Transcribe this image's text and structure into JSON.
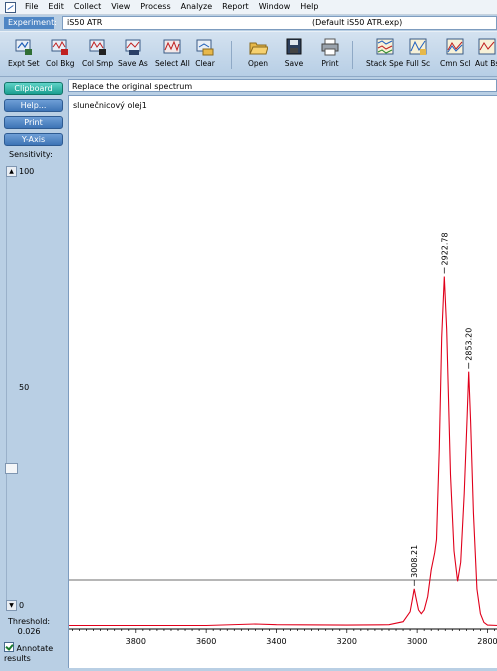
{
  "menu": {
    "items": [
      "File",
      "Edit",
      "Collect",
      "View",
      "Process",
      "Analyze",
      "Report",
      "Window",
      "Help"
    ]
  },
  "experiment": {
    "label": "Experiment:",
    "value": "iS50 ATR",
    "file": "(Default iS50 ATR.exp)"
  },
  "toolbar": {
    "buttons": [
      {
        "label": "Expt Set",
        "icon": "experiment-setup-icon"
      },
      {
        "label": "Col Bkg",
        "icon": "collect-background-icon"
      },
      {
        "label": "Col Smp",
        "icon": "collect-sample-icon"
      },
      {
        "label": "Save As",
        "icon": "save-as-icon"
      },
      {
        "label": "Select All",
        "icon": "select-all-icon"
      },
      {
        "label": "Clear",
        "icon": "clear-icon"
      },
      {
        "label": "Open",
        "icon": "open-folder-icon"
      },
      {
        "label": "Save",
        "icon": "floppy-disk-icon"
      },
      {
        "label": "Print",
        "icon": "printer-icon"
      },
      {
        "label": "Stack Spe",
        "icon": "stack-spectra-icon"
      },
      {
        "label": "Full Sc",
        "icon": "full-scale-icon"
      },
      {
        "label": "Cmn Scl",
        "icon": "common-scale-icon"
      },
      {
        "label": "Aut Bs",
        "icon": "auto-baseline-icon"
      }
    ]
  },
  "left_panel": {
    "buttons": [
      "Clipboard",
      "Help...",
      "Print",
      "Y-Axis"
    ],
    "sensitivity_label": "Sensitivity:",
    "scale_top": "100",
    "scale_mid": "50",
    "scale_bottom": "0",
    "threshold_label": "Threshold:",
    "threshold_value": "0.026",
    "annotate_label": "Annotate results",
    "annotate_checked": true
  },
  "title_field": "Replace the original spectrum",
  "spectrum_name": "slunečnicový olej1",
  "colors": {
    "spectrum": "#e0001b",
    "threshold_line": "#6e6e6e",
    "accent": "#4f86c4",
    "active_button": "#1b9e91"
  },
  "chart_data": {
    "type": "line",
    "title": "",
    "xlabel": "",
    "ylabel": "",
    "x_reversed": true,
    "xlim": [
      3990,
      2770
    ],
    "ylim": [
      0,
      1
    ],
    "x_ticks": [
      "3800",
      "3600",
      "3400",
      "3200",
      "3000",
      "2800"
    ],
    "threshold": 0.026,
    "series": [
      {
        "points": [
          [
            3990,
            0.004
          ],
          [
            3800,
            0.004
          ],
          [
            3600,
            0.004
          ],
          [
            3460,
            0.008
          ],
          [
            3400,
            0.006
          ],
          [
            3200,
            0.005
          ],
          [
            3080,
            0.006
          ],
          [
            3040,
            0.014
          ],
          [
            3020,
            0.04
          ],
          [
            3012,
            0.08
          ],
          [
            3008.21,
            0.1
          ],
          [
            3004,
            0.08
          ],
          [
            2996,
            0.045
          ],
          [
            2988,
            0.035
          ],
          [
            2980,
            0.045
          ],
          [
            2970,
            0.08
          ],
          [
            2960,
            0.15
          ],
          [
            2950,
            0.195
          ],
          [
            2945,
            0.23
          ],
          [
            2937,
            0.47
          ],
          [
            2930,
            0.76
          ],
          [
            2922.78,
            0.92
          ],
          [
            2916,
            0.78
          ],
          [
            2905,
            0.4
          ],
          [
            2895,
            0.2
          ],
          [
            2885,
            0.12
          ],
          [
            2876,
            0.17
          ],
          [
            2866,
            0.35
          ],
          [
            2858,
            0.55
          ],
          [
            2853.2,
            0.67
          ],
          [
            2848,
            0.54
          ],
          [
            2840,
            0.3
          ],
          [
            2830,
            0.1
          ],
          [
            2820,
            0.035
          ],
          [
            2810,
            0.012
          ],
          [
            2800,
            0.005
          ],
          [
            2770,
            0.004
          ]
        ]
      }
    ],
    "peak_labels": [
      {
        "x": 3008.21,
        "y": 0.1,
        "text": "3008.21"
      },
      {
        "x": 2922.78,
        "y": 0.92,
        "text": "2922.78"
      },
      {
        "x": 2853.2,
        "y": 0.67,
        "text": "2853.20"
      }
    ]
  }
}
